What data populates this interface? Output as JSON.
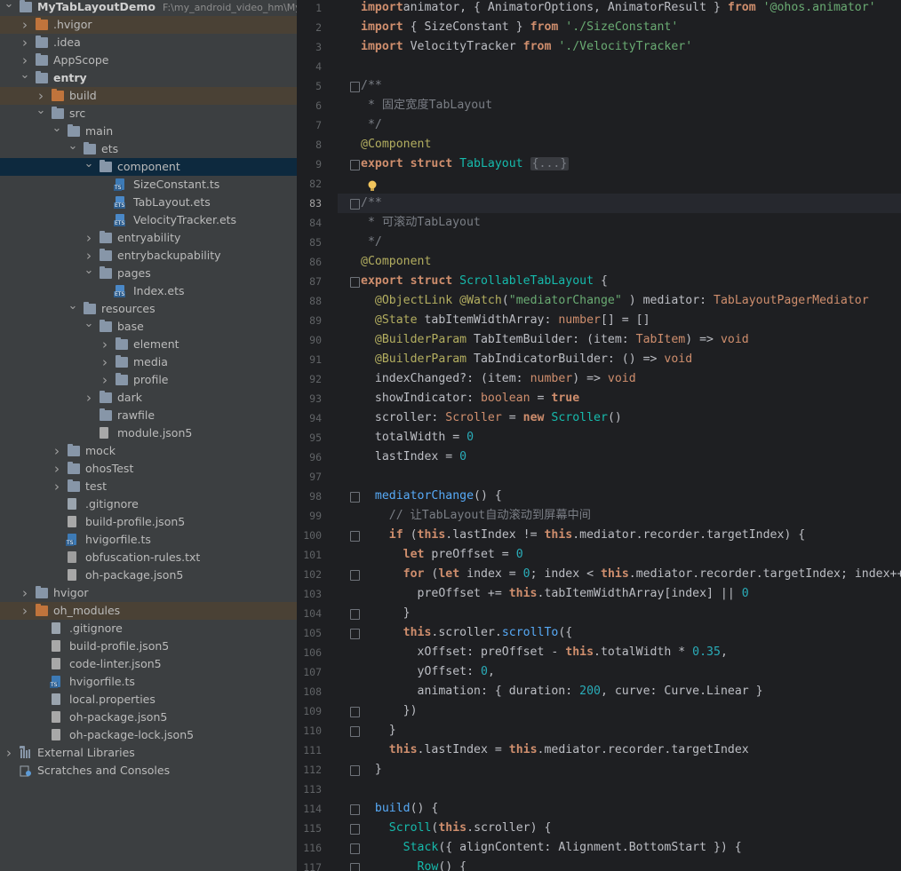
{
  "project_tree": {
    "rows": [
      {
        "label": "MyTabLayoutDemo",
        "path": "F:\\my_android_video_hm\\My",
        "depth": 0,
        "arrow": "down",
        "icon": "folder",
        "bold": true,
        "hl": ""
      },
      {
        "label": ".hvigor",
        "depth": 1,
        "arrow": "right",
        "icon": "folder-orange",
        "hl": "brown"
      },
      {
        "label": ".idea",
        "depth": 1,
        "arrow": "right",
        "icon": "folder",
        "hl": ""
      },
      {
        "label": "AppScope",
        "depth": 1,
        "arrow": "right",
        "icon": "folder",
        "hl": ""
      },
      {
        "label": "entry",
        "depth": 1,
        "arrow": "down",
        "icon": "folder",
        "bold": true,
        "hl": ""
      },
      {
        "label": "build",
        "depth": 2,
        "arrow": "right",
        "icon": "folder-orange",
        "hl": "brown"
      },
      {
        "label": "src",
        "depth": 2,
        "arrow": "down",
        "icon": "folder",
        "hl": ""
      },
      {
        "label": "main",
        "depth": 3,
        "arrow": "down",
        "icon": "folder",
        "hl": ""
      },
      {
        "label": "ets",
        "depth": 4,
        "arrow": "down",
        "icon": "folder",
        "hl": ""
      },
      {
        "label": "component",
        "depth": 5,
        "arrow": "down",
        "icon": "folder",
        "hl": "sel"
      },
      {
        "label": "SizeConstant.ts",
        "depth": 6,
        "arrow": "",
        "icon": "file-ts",
        "hl": ""
      },
      {
        "label": "TabLayout.ets",
        "depth": 6,
        "arrow": "",
        "icon": "file-ets",
        "hl": ""
      },
      {
        "label": "VelocityTracker.ets",
        "depth": 6,
        "arrow": "",
        "icon": "file-ets",
        "hl": ""
      },
      {
        "label": "entryability",
        "depth": 5,
        "arrow": "right",
        "icon": "folder",
        "hl": ""
      },
      {
        "label": "entrybackupability",
        "depth": 5,
        "arrow": "right",
        "icon": "folder",
        "hl": ""
      },
      {
        "label": "pages",
        "depth": 5,
        "arrow": "down",
        "icon": "folder",
        "hl": ""
      },
      {
        "label": "Index.ets",
        "depth": 6,
        "arrow": "",
        "icon": "file-ets",
        "hl": ""
      },
      {
        "label": "resources",
        "depth": 4,
        "arrow": "down",
        "icon": "folder",
        "hl": ""
      },
      {
        "label": "base",
        "depth": 5,
        "arrow": "down",
        "icon": "folder",
        "hl": ""
      },
      {
        "label": "element",
        "depth": 6,
        "arrow": "right",
        "icon": "folder",
        "hl": ""
      },
      {
        "label": "media",
        "depth": 6,
        "arrow": "right",
        "icon": "folder",
        "hl": ""
      },
      {
        "label": "profile",
        "depth": 6,
        "arrow": "right",
        "icon": "folder",
        "hl": ""
      },
      {
        "label": "dark",
        "depth": 5,
        "arrow": "right",
        "icon": "folder",
        "hl": ""
      },
      {
        "label": "rawfile",
        "depth": 5,
        "arrow": "",
        "icon": "folder",
        "hl": ""
      },
      {
        "label": "module.json5",
        "depth": 5,
        "arrow": "",
        "icon": "file-json",
        "hl": ""
      },
      {
        "label": "mock",
        "depth": 3,
        "arrow": "right",
        "icon": "folder",
        "hl": ""
      },
      {
        "label": "ohosTest",
        "depth": 3,
        "arrow": "right",
        "icon": "folder",
        "hl": ""
      },
      {
        "label": "test",
        "depth": 3,
        "arrow": "right",
        "icon": "folder",
        "hl": ""
      },
      {
        "label": ".gitignore",
        "depth": 3,
        "arrow": "",
        "icon": "file",
        "hl": ""
      },
      {
        "label": "build-profile.json5",
        "depth": 3,
        "arrow": "",
        "icon": "file-json",
        "hl": ""
      },
      {
        "label": "hvigorfile.ts",
        "depth": 3,
        "arrow": "",
        "icon": "file-ts",
        "hl": ""
      },
      {
        "label": "obfuscation-rules.txt",
        "depth": 3,
        "arrow": "",
        "icon": "file-txt",
        "hl": ""
      },
      {
        "label": "oh-package.json5",
        "depth": 3,
        "arrow": "",
        "icon": "file-json",
        "hl": ""
      },
      {
        "label": "hvigor",
        "depth": 1,
        "arrow": "right",
        "icon": "folder",
        "hl": ""
      },
      {
        "label": "oh_modules",
        "depth": 1,
        "arrow": "right",
        "icon": "folder-orange",
        "hl": "brown"
      },
      {
        "label": ".gitignore",
        "depth": 2,
        "arrow": "",
        "icon": "file",
        "hl": ""
      },
      {
        "label": "build-profile.json5",
        "depth": 2,
        "arrow": "",
        "icon": "file-json",
        "hl": ""
      },
      {
        "label": "code-linter.json5",
        "depth": 2,
        "arrow": "",
        "icon": "file-json",
        "hl": ""
      },
      {
        "label": "hvigorfile.ts",
        "depth": 2,
        "arrow": "",
        "icon": "file-ts",
        "hl": ""
      },
      {
        "label": "local.properties",
        "depth": 2,
        "arrow": "",
        "icon": "file",
        "hl": ""
      },
      {
        "label": "oh-package.json5",
        "depth": 2,
        "arrow": "",
        "icon": "file-json",
        "hl": ""
      },
      {
        "label": "oh-package-lock.json5",
        "depth": 2,
        "arrow": "",
        "icon": "file-json",
        "hl": ""
      },
      {
        "label": "External Libraries",
        "depth": 0,
        "arrow": "right",
        "icon": "library",
        "hl": ""
      },
      {
        "label": "Scratches and Consoles",
        "depth": 0,
        "arrow": "",
        "icon": "scratch",
        "hl": ""
      }
    ]
  },
  "editor": {
    "current_line": "83",
    "lines": [
      {
        "n": "1",
        "fold": false,
        "tokens": [
          [
            "kwb",
            "import"
          ],
          [
            "",
            "animator, { AnimatorOptions, AnimatorResult } "
          ],
          [
            "kwb",
            "from"
          ],
          [
            "",
            ""
          ],
          [
            "str",
            " '@ohos.animator'"
          ]
        ]
      },
      {
        "n": "2",
        "fold": false,
        "tokens": [
          [
            "kwb",
            "import"
          ],
          [
            "",
            " { SizeConstant } "
          ],
          [
            "kwb",
            "from"
          ],
          [
            "str",
            " './SizeConstant'"
          ]
        ]
      },
      {
        "n": "3",
        "fold": false,
        "tokens": [
          [
            "kwb",
            "import"
          ],
          [
            "",
            " VelocityTracker "
          ],
          [
            "kwb",
            "from"
          ],
          [
            "str",
            " './VelocityTracker'"
          ]
        ]
      },
      {
        "n": "4",
        "fold": false,
        "tokens": []
      },
      {
        "n": "5",
        "fold": true,
        "tokens": [
          [
            "cmt",
            "/**"
          ]
        ]
      },
      {
        "n": "6",
        "fold": false,
        "tokens": [
          [
            "cmt",
            " * 固定宽度TabLayout"
          ]
        ]
      },
      {
        "n": "7",
        "fold": false,
        "tokens": [
          [
            "cmt",
            " */"
          ]
        ]
      },
      {
        "n": "8",
        "fold": false,
        "tokens": [
          [
            "ann",
            "@Component"
          ]
        ]
      },
      {
        "n": "9",
        "fold": true,
        "tokens": [
          [
            "kwb",
            "export struct "
          ],
          [
            "typ",
            "TabLayout "
          ],
          [
            "fold",
            "{...}"
          ]
        ]
      },
      {
        "n": "82",
        "fold": false,
        "bulb": true,
        "tokens": []
      },
      {
        "n": "83",
        "fold": true,
        "tokens": [
          [
            "cmt",
            "/**"
          ]
        ]
      },
      {
        "n": "84",
        "fold": false,
        "tokens": [
          [
            "cmt",
            " * 可滚动TabLayout"
          ]
        ]
      },
      {
        "n": "85",
        "fold": false,
        "tokens": [
          [
            "cmt",
            " */"
          ]
        ]
      },
      {
        "n": "86",
        "fold": false,
        "tokens": [
          [
            "ann",
            "@Component"
          ]
        ]
      },
      {
        "n": "87",
        "fold": true,
        "tokens": [
          [
            "kwb",
            "export struct "
          ],
          [
            "typ",
            "ScrollableTabLayout"
          ],
          [
            "",
            " {"
          ]
        ]
      },
      {
        "n": "88",
        "fold": false,
        "tokens": [
          [
            "ann",
            "  @ObjectLink @Watch"
          ],
          [
            "",
            "("
          ],
          [
            "str",
            "\"mediatorChange\""
          ],
          [
            "",
            " ) mediator: "
          ],
          [
            "kw",
            "TabLayoutPagerMediator"
          ]
        ]
      },
      {
        "n": "89",
        "fold": false,
        "tokens": [
          [
            "ann",
            "  @State"
          ],
          [
            "",
            " tabItemWidthArray: "
          ],
          [
            "kw",
            "number"
          ],
          [
            "",
            "[] = []"
          ]
        ]
      },
      {
        "n": "90",
        "fold": false,
        "tokens": [
          [
            "ann",
            "  @BuilderParam"
          ],
          [
            "",
            " TabItemBuilder: ("
          ],
          [
            "",
            "item: "
          ],
          [
            "kw",
            "TabItem"
          ],
          [
            "",
            ") => "
          ],
          [
            "kw",
            "void"
          ]
        ]
      },
      {
        "n": "91",
        "fold": false,
        "tokens": [
          [
            "ann",
            "  @BuilderParam"
          ],
          [
            "",
            " TabIndicatorBuilder: () => "
          ],
          [
            "kw",
            "void"
          ]
        ]
      },
      {
        "n": "92",
        "fold": false,
        "tokens": [
          [
            "",
            "  indexChanged?: (item: "
          ],
          [
            "kw",
            "number"
          ],
          [
            "",
            ") => "
          ],
          [
            "kw",
            "void"
          ]
        ]
      },
      {
        "n": "93",
        "fold": false,
        "tokens": [
          [
            "",
            "  showIndicator: "
          ],
          [
            "kw",
            "boolean"
          ],
          [
            "",
            " = "
          ],
          [
            "kwb",
            "true"
          ]
        ]
      },
      {
        "n": "94",
        "fold": false,
        "tokens": [
          [
            "",
            "  scroller: "
          ],
          [
            "kw",
            "Scroller"
          ],
          [
            "",
            " = "
          ],
          [
            "kwb",
            "new "
          ],
          [
            "typ",
            "Scroller"
          ],
          [
            "",
            "()"
          ]
        ]
      },
      {
        "n": "95",
        "fold": false,
        "tokens": [
          [
            "",
            "  totalWidth = "
          ],
          [
            "num",
            "0"
          ]
        ]
      },
      {
        "n": "96",
        "fold": false,
        "tokens": [
          [
            "",
            "  lastIndex = "
          ],
          [
            "num",
            "0"
          ]
        ]
      },
      {
        "n": "97",
        "fold": false,
        "tokens": []
      },
      {
        "n": "98",
        "fold": true,
        "tokens": [
          [
            "fn",
            "  mediatorChange"
          ],
          [
            "",
            "() {"
          ]
        ]
      },
      {
        "n": "99",
        "fold": false,
        "tokens": [
          [
            "cmt",
            "    // 让TabLayout自动滚动到屏幕中间"
          ]
        ]
      },
      {
        "n": "100",
        "fold": true,
        "tokens": [
          [
            "kwb",
            "    if"
          ],
          [
            "",
            " ("
          ],
          [
            "kwb",
            "this"
          ],
          [
            "",
            ".lastIndex != "
          ],
          [
            "kwb",
            "this"
          ],
          [
            "",
            ".mediator.recorder.targetIndex) {"
          ]
        ]
      },
      {
        "n": "101",
        "fold": false,
        "tokens": [
          [
            "kwb",
            "      let"
          ],
          [
            "",
            " preOffset = "
          ],
          [
            "num",
            "0"
          ]
        ]
      },
      {
        "n": "102",
        "fold": true,
        "tokens": [
          [
            "kwb",
            "      for"
          ],
          [
            "",
            " ("
          ],
          [
            "kwb",
            "let"
          ],
          [
            "",
            " index = "
          ],
          [
            "num",
            "0"
          ],
          [
            "",
            "; index < "
          ],
          [
            "kwb",
            "this"
          ],
          [
            "",
            ".mediator.recorder.targetIndex; index++"
          ]
        ]
      },
      {
        "n": "103",
        "fold": false,
        "tokens": [
          [
            "",
            "        preOffset += "
          ],
          [
            "kwb",
            "this"
          ],
          [
            "",
            ".tabItemWidthArray[index] || "
          ],
          [
            "num",
            "0"
          ]
        ]
      },
      {
        "n": "104",
        "fold": true,
        "tokens": [
          [
            "",
            "      }"
          ]
        ]
      },
      {
        "n": "105",
        "fold": true,
        "tokens": [
          [
            "kwb",
            "      this"
          ],
          [
            "",
            ".scroller."
          ],
          [
            "fn",
            "scrollTo"
          ],
          [
            "",
            "({"
          ]
        ]
      },
      {
        "n": "106",
        "fold": false,
        "tokens": [
          [
            "",
            "        xOffset: preOffset - "
          ],
          [
            "kwb",
            "this"
          ],
          [
            "",
            ".totalWidth * "
          ],
          [
            "num",
            "0.35"
          ],
          [
            "",
            ","
          ]
        ]
      },
      {
        "n": "107",
        "fold": false,
        "tokens": [
          [
            "",
            "        yOffset: "
          ],
          [
            "num",
            "0"
          ],
          [
            "",
            ","
          ]
        ]
      },
      {
        "n": "108",
        "fold": false,
        "tokens": [
          [
            "",
            "        animation: { duration: "
          ],
          [
            "num",
            "200"
          ],
          [
            "",
            ", curve: Curve.Linear }"
          ]
        ]
      },
      {
        "n": "109",
        "fold": true,
        "tokens": [
          [
            "",
            "      })"
          ]
        ]
      },
      {
        "n": "110",
        "fold": true,
        "tokens": [
          [
            "",
            "    }"
          ]
        ]
      },
      {
        "n": "111",
        "fold": false,
        "tokens": [
          [
            "kwb",
            "    this"
          ],
          [
            "",
            ".lastIndex = "
          ],
          [
            "kwb",
            "this"
          ],
          [
            "",
            ".mediator.recorder.targetIndex"
          ]
        ]
      },
      {
        "n": "112",
        "fold": true,
        "tokens": [
          [
            "",
            "  }"
          ]
        ]
      },
      {
        "n": "113",
        "fold": false,
        "tokens": []
      },
      {
        "n": "114",
        "fold": true,
        "tokens": [
          [
            "fn",
            "  build"
          ],
          [
            "",
            "() {"
          ]
        ]
      },
      {
        "n": "115",
        "fold": true,
        "tokens": [
          [
            "typ",
            "    Scroll"
          ],
          [
            "",
            "("
          ],
          [
            "kwb",
            "this"
          ],
          [
            "",
            ".scroller) {"
          ]
        ]
      },
      {
        "n": "116",
        "fold": true,
        "tokens": [
          [
            "typ",
            "      Stack"
          ],
          [
            "",
            "({ alignContent: Alignment.BottomStart }) {"
          ]
        ]
      },
      {
        "n": "117",
        "fold": true,
        "tokens": [
          [
            "typ",
            "        Row"
          ],
          [
            "",
            "() {"
          ]
        ]
      }
    ]
  }
}
